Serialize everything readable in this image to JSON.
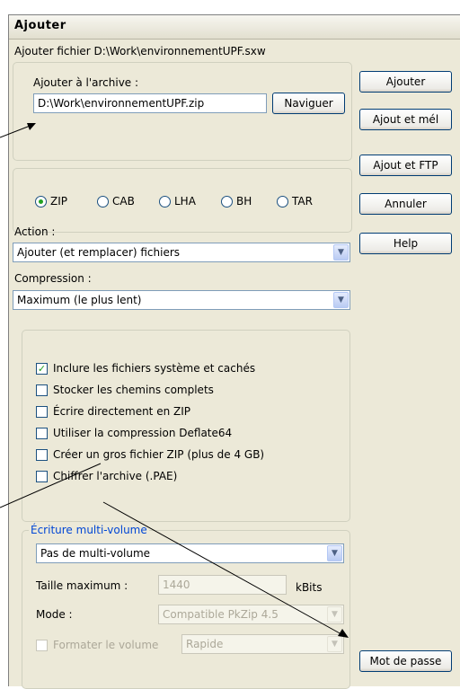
{
  "window": {
    "title": "Ajouter"
  },
  "file_label": "Ajouter fichier D:\\Work\\environnementUPF.sxw",
  "archive": {
    "label": "Ajouter à l'archive :",
    "value": "D:\\Work\\environnementUPF.zip",
    "browse_label": "Naviguer"
  },
  "formats": [
    {
      "label": "ZIP",
      "selected": true
    },
    {
      "label": "CAB",
      "selected": false
    },
    {
      "label": "LHA",
      "selected": false
    },
    {
      "label": "BH",
      "selected": false
    },
    {
      "label": "TAR",
      "selected": false
    }
  ],
  "action": {
    "label": "Action :",
    "value": "Ajouter (et remplacer) fichiers"
  },
  "compression": {
    "label": "Compression :",
    "value": "Maximum (le plus lent)"
  },
  "options": [
    {
      "label": "Inclure les fichiers système et cachés",
      "checked": true
    },
    {
      "label": "Stocker les chemins complets",
      "checked": false
    },
    {
      "label": "Écrire directement en ZIP",
      "checked": false
    },
    {
      "label": "Utiliser la compression Deflate64",
      "checked": false
    },
    {
      "label": "Créer un gros fichier ZIP (plus de 4 GB)",
      "checked": false
    },
    {
      "label": "Chiffrer l'archive (.PAE)",
      "checked": false
    }
  ],
  "multivolume": {
    "legend": "Écriture multi-volume",
    "value": "Pas de multi-volume",
    "max_size_label": "Taille maximum :",
    "max_size_value": "1440",
    "max_size_unit": "kBits",
    "mode_label": "Mode :",
    "mode_value": "Compatible PkZip 4.5",
    "format_label": "Formater le volume",
    "format_value": "Rapide"
  },
  "buttons": {
    "add": "Ajouter",
    "add_mail": "Ajout et mél",
    "add_ftp": "Ajout et FTP",
    "cancel": "Annuler",
    "help": "Help",
    "password": "Mot de passe"
  }
}
